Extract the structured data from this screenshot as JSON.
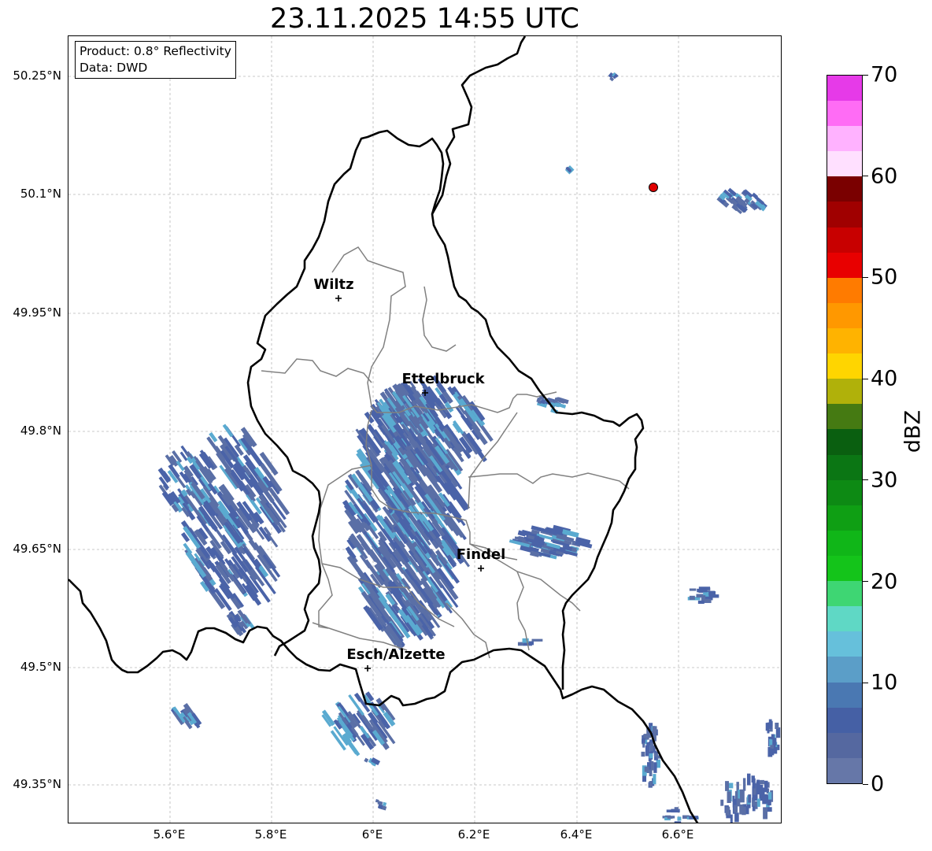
{
  "title": "23.11.2025 14:55 UTC",
  "info": {
    "product": "Product: 0.8° Reflectivity",
    "data": "Data: DWD"
  },
  "lat_labels": [
    "50.25°N",
    "50.1°N",
    "49.95°N",
    "49.8°N",
    "49.65°N",
    "49.5°N",
    "49.35°N"
  ],
  "lon_labels": [
    "5.6°E",
    "5.8°E",
    "6°E",
    "6.2°E",
    "6.4°E",
    "6.6°E"
  ],
  "cities": [
    {
      "name": "Wiltz"
    },
    {
      "name": "Ettelbruck"
    },
    {
      "name": "Findel"
    },
    {
      "name": "Esch/Alzette"
    }
  ],
  "colorbar": {
    "title": "dBZ",
    "tick_labels": [
      "0",
      "10",
      "20",
      "30",
      "40",
      "50",
      "60",
      "70"
    ],
    "colors": [
      "#6677a8",
      "#5568a0",
      "#4560a5",
      "#4a78b2",
      "#5b9ec8",
      "#66c0db",
      "#5fd8c5",
      "#3ed673",
      "#14c41a",
      "#10b618",
      "#0f9f14",
      "#0d8a14",
      "#0b7614",
      "#0a5f10",
      "#457a12",
      "#b0b10a",
      "#ffd500",
      "#ffb300",
      "#ff9800",
      "#ff7b00",
      "#e80000",
      "#c80000",
      "#a00000",
      "#7a0000",
      "#ffe0ff",
      "#ffb2ff",
      "#ff6cf5",
      "#e63ae8"
    ]
  },
  "colors": {
    "radar_base": "#5a6fa6",
    "radar_mid": "#4a63a8",
    "radar_light": "#5aaad0",
    "border": "#000000",
    "canton_border": "#808080",
    "gridline": "#b8b8b8",
    "marker": "#e00000"
  }
}
